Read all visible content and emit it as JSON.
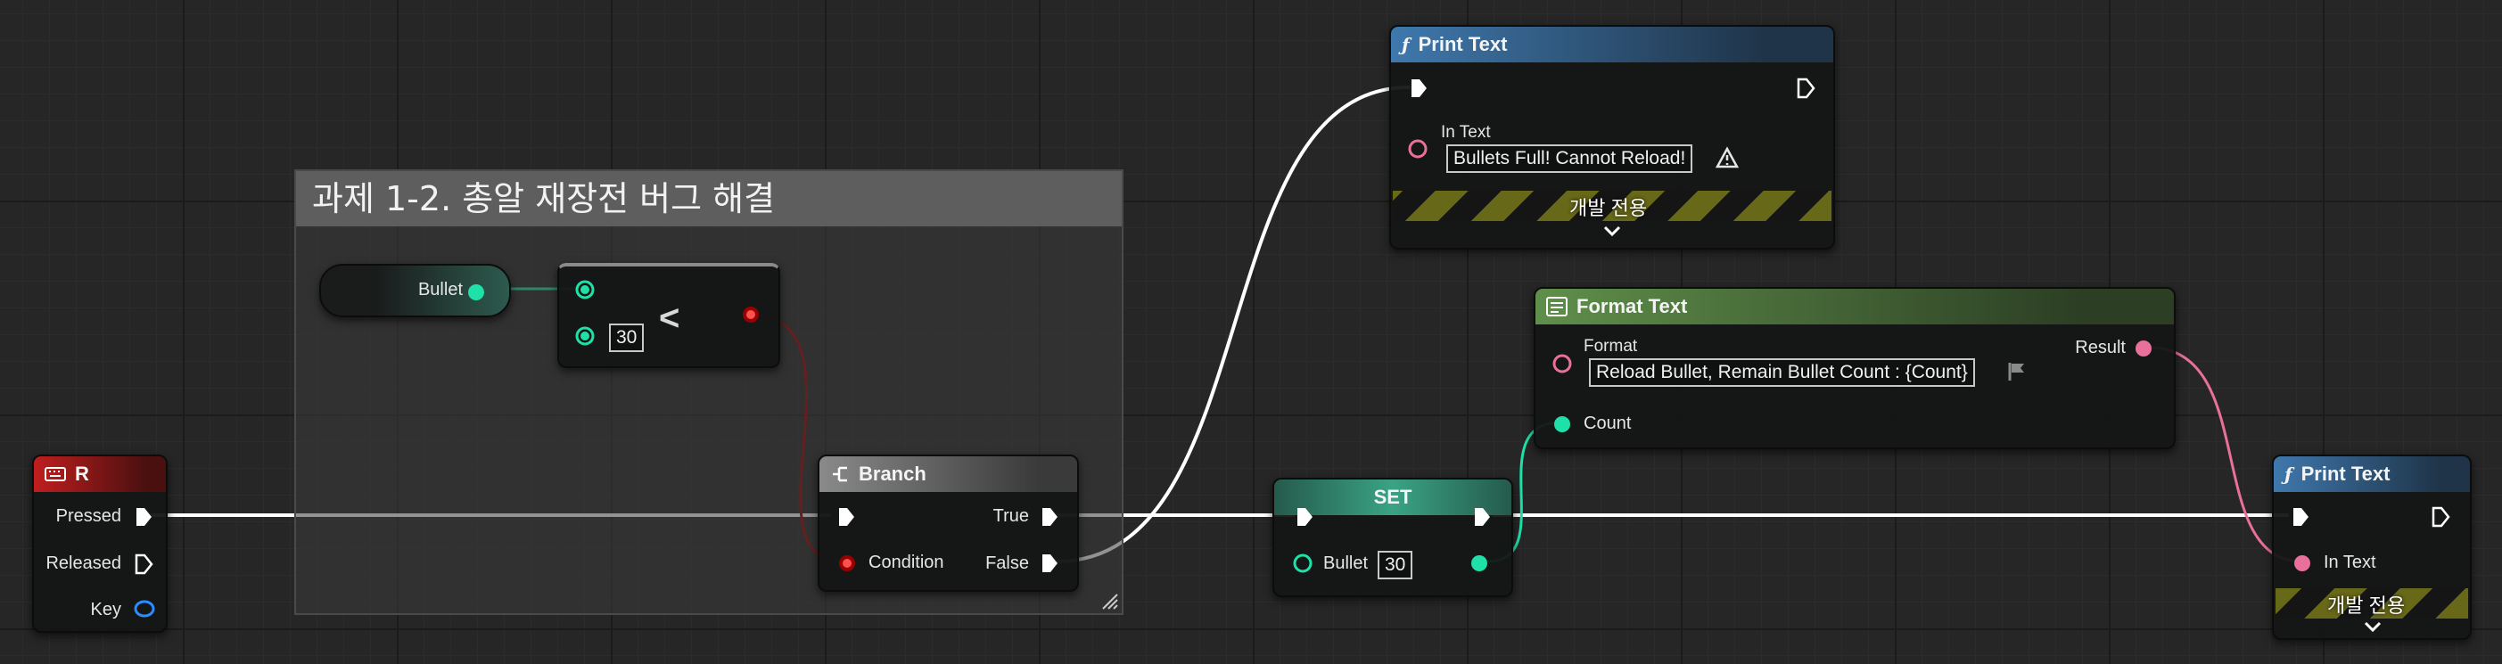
{
  "comment": {
    "title": "과제 1-2. 총알 재장전 버그 해결"
  },
  "nodes": {
    "event_r": {
      "title": "R",
      "pins": {
        "pressed": "Pressed",
        "released": "Released",
        "key": "Key"
      }
    },
    "get_bullet": {
      "label": "Bullet"
    },
    "less_than": {
      "operator": "<",
      "b_value": "30"
    },
    "branch": {
      "title": "Branch",
      "condition": "Condition",
      "true": "True",
      "false": "False"
    },
    "set": {
      "title": "SET",
      "var": "Bullet",
      "value": "30"
    },
    "print_full": {
      "title": "Print Text",
      "in_text": "In Text",
      "value": "Bullets Full! Cannot Reload!",
      "dev_only": "개발 전용"
    },
    "format_text": {
      "title": "Format Text",
      "format_label": "Format",
      "format_value": "Reload Bullet, Remain Bullet Count : {Count}",
      "count_pin": "Count",
      "result_pin": "Result"
    },
    "print_reload": {
      "title": "Print Text",
      "in_text": "In Text",
      "dev_only": "개발 전용"
    }
  },
  "colors": {
    "exec_wire": "#ffffff",
    "int_pin": "#1fe0a8",
    "bool_pin": "#960000",
    "text_pin": "#e8709a",
    "event_header": "#c01e1e",
    "function_header": "#3f78ad",
    "pure_header": "#5f8f4a",
    "dev_stripe": "#686819"
  },
  "icons": {
    "event": "keyboard-icon",
    "function": "function-icon",
    "format": "format-text-icon",
    "branch": "branch-icon",
    "warning": "warning-icon",
    "localization": "flag-icon"
  }
}
